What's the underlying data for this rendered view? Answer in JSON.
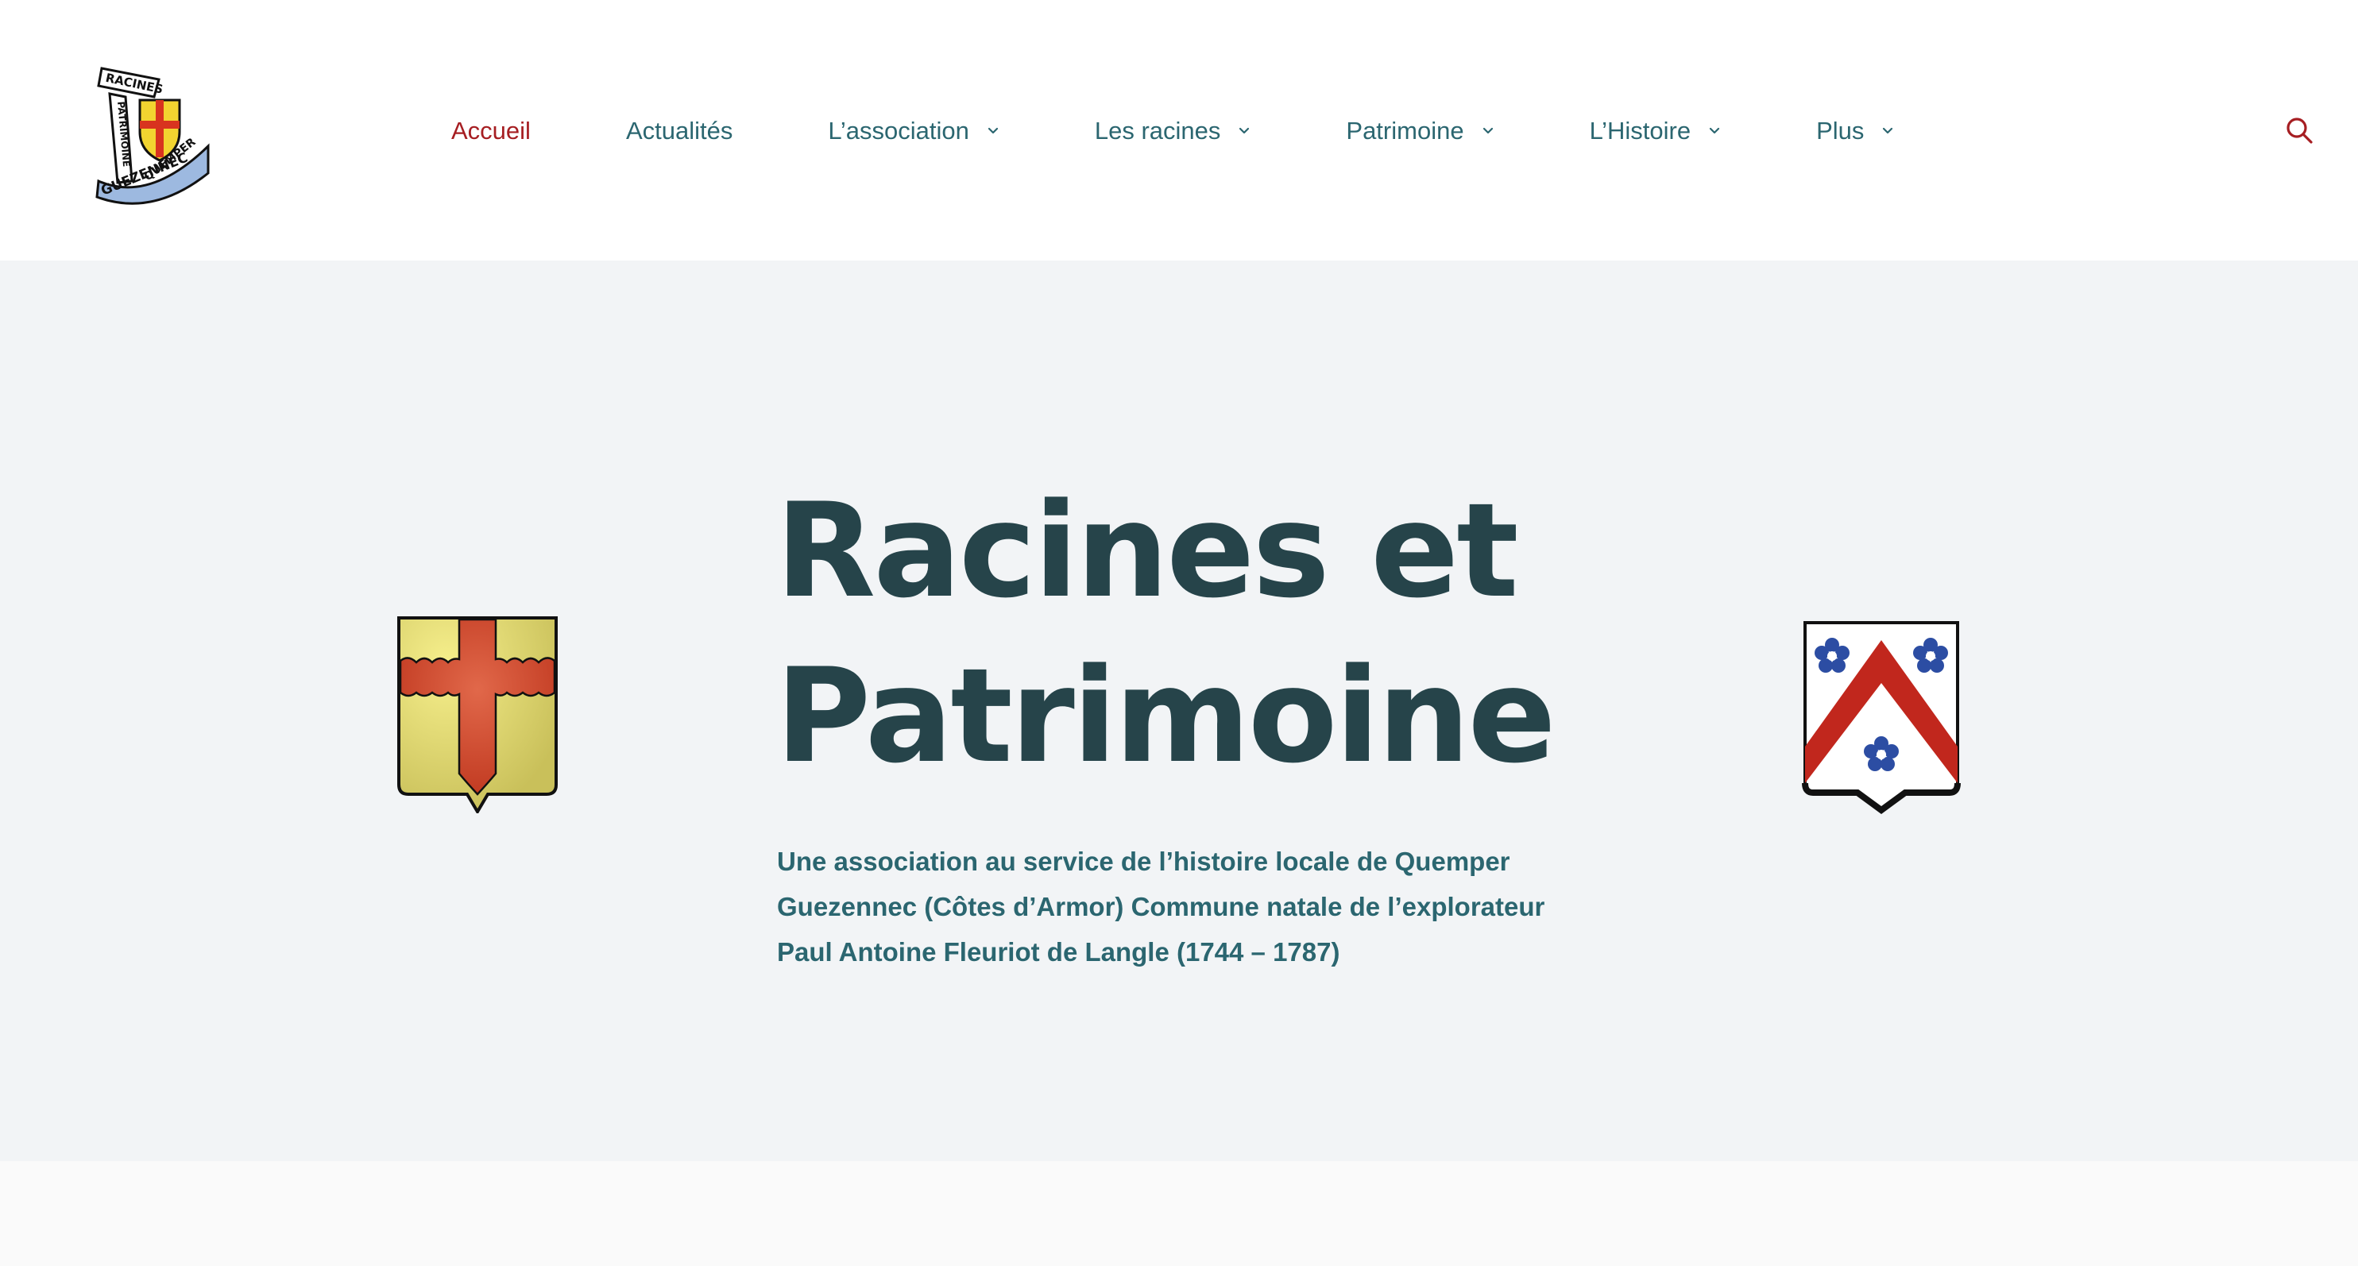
{
  "header": {
    "nav": [
      {
        "label": "Accueil",
        "active": true,
        "dropdown": false
      },
      {
        "label": "Actualités",
        "active": false,
        "dropdown": false
      },
      {
        "label": "L’association",
        "active": false,
        "dropdown": true
      },
      {
        "label": "Les racines",
        "active": false,
        "dropdown": true
      },
      {
        "label": "Patrimoine",
        "active": false,
        "dropdown": true
      },
      {
        "label": "L’Histoire",
        "active": false,
        "dropdown": true
      },
      {
        "label": "Plus",
        "active": false,
        "dropdown": true
      }
    ],
    "search_icon": "search-icon"
  },
  "logo": {
    "text_top": "RACINES",
    "text_side": "PATRIMOINE",
    "text_arc1": "QUEMPER",
    "text_arc2": "GUEZENNEC"
  },
  "hero": {
    "title_line1": "Racines et",
    "title_line2": "Patrimoine",
    "subtitle_line1": "Une association au service de l’histoire locale de Quemper",
    "subtitle_line2": "Guezennec (Côtes d’Armor) Commune natale de l’explorateur",
    "subtitle_line3": "Paul Antoine Fleuriot de Langle (1744 – 1787)"
  },
  "colors": {
    "nav_text": "#2b6670",
    "nav_active": "#a61e22",
    "title": "#26444a",
    "hero_bg": "#f2f4f6"
  }
}
